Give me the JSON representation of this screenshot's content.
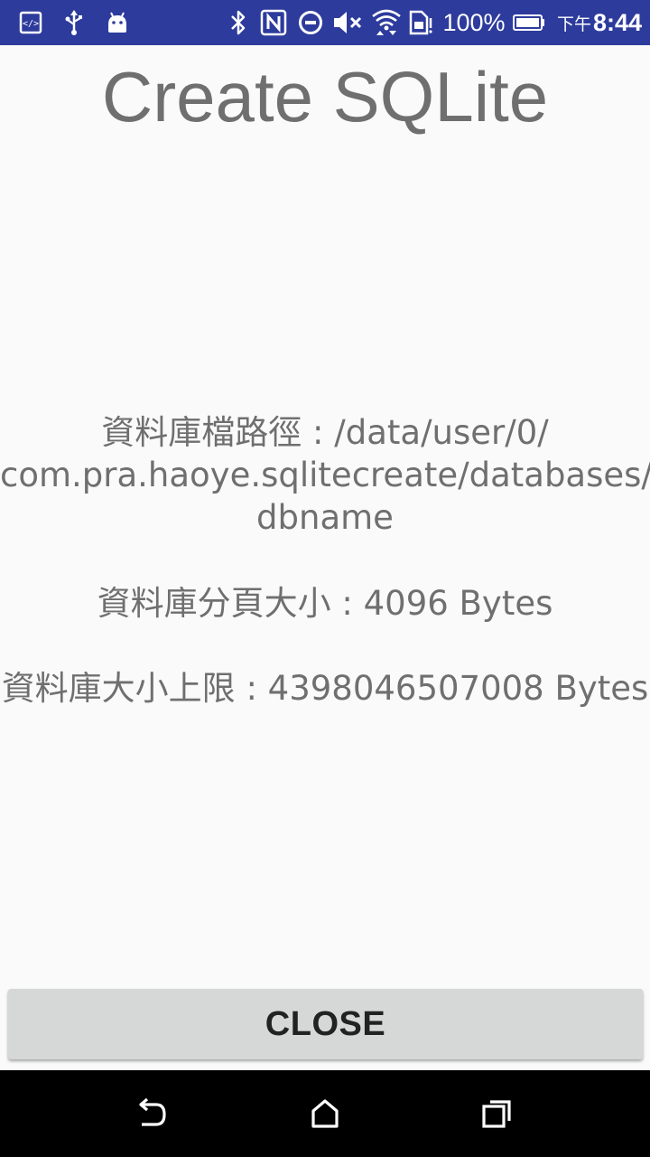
{
  "status_bar": {
    "battery_percent": "100%",
    "time_period": "下午",
    "time": "8:44",
    "background_color": "#2d3b9c",
    "icons": [
      "developer-mode-icon",
      "usb-icon",
      "android-icon",
      "bluetooth-icon",
      "nfc-icon",
      "do-not-disturb-icon",
      "volume-muted-icon",
      "wifi-icon",
      "sim-icon",
      "battery-icon"
    ]
  },
  "app": {
    "title": "Create SQLite",
    "db_path_line1": "資料庫檔路徑 : /data/user/0/",
    "db_path_line2": "com.pra.haoye.sqlitecreate/databases/",
    "db_path_line3": "dbname",
    "page_size_text": "資料庫分頁大小 : 4096 Bytes",
    "max_size_text": "資料庫大小上限 : 4398046507008 Bytes",
    "close_label": "CLOSE"
  },
  "nav_bar": {
    "icons": [
      "back-icon",
      "home-icon",
      "recents-icon"
    ]
  }
}
